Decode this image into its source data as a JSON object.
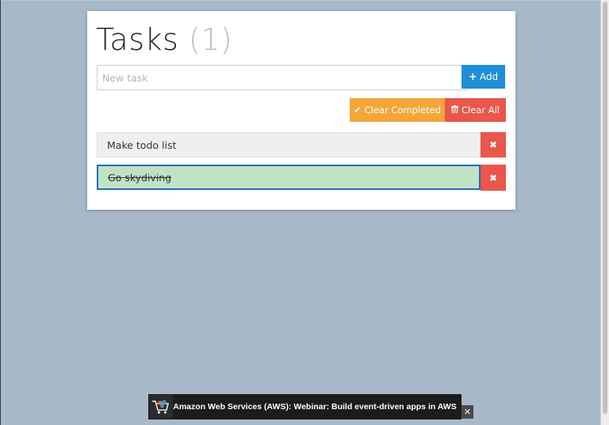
{
  "app": {
    "title": "Tasks",
    "count": "(1)"
  },
  "input": {
    "placeholder": "New task",
    "value": ""
  },
  "buttons": {
    "add_icon": "+",
    "add_label": "Add",
    "clear_completed_icon": "✔",
    "clear_completed_label": "Clear Completed",
    "clear_all_icon": "trash-icon",
    "clear_all_label": "Clear All",
    "delete_icon": "✖"
  },
  "tasks": [
    {
      "text": "Make todo list",
      "completed": false
    },
    {
      "text": "Go skydiving",
      "completed": true
    }
  ],
  "ad": {
    "text": "Amazon Web Services (AWS): Webinar: Build event-driven apps in AWS",
    "close": "✕"
  },
  "colors": {
    "background": "#a7b8c8",
    "add": "#1f8ed6",
    "clear_completed": "#f5a63a",
    "danger": "#e9564b",
    "completed_row": "#c0e3c6"
  }
}
